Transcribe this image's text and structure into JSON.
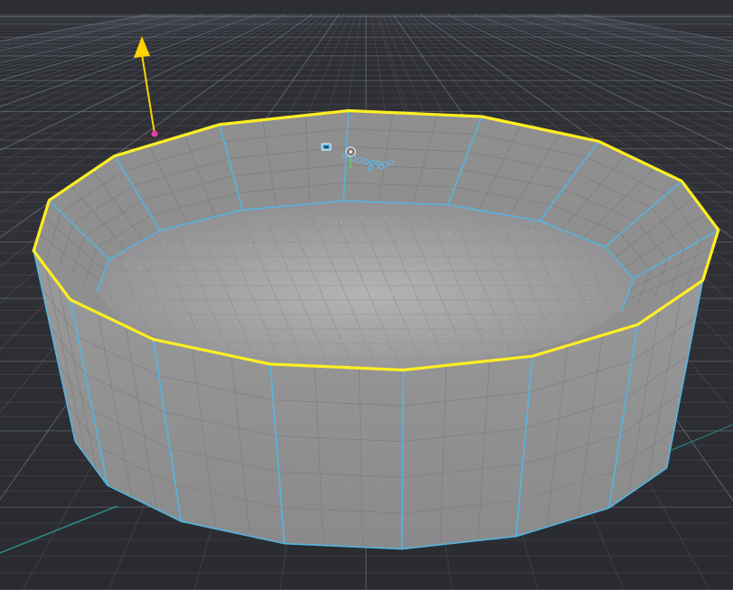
{
  "viewport": {
    "mode": "edit-mesh",
    "background_color": "#2d2e33",
    "grid_color": "#7a8292",
    "grid_accent_color": "#8a5a3a",
    "axis_line_color": "#2a9e9e"
  },
  "mesh": {
    "shape": "open cylinder",
    "sides": 16,
    "wall_rows": 5,
    "wall_cols_per_side": 3,
    "surface_color": "#8f8f90",
    "floor_color": "#a4a4a6",
    "edge_color": "#4fb8e8",
    "selected_edge_loop": "top rim",
    "selected_edge_color": "#ffee22"
  },
  "gizmo": {
    "axis_arrow_color": "#ffd400",
    "handle_color": "#e040a0"
  },
  "widgets": {
    "camera_icon": "camera-icon",
    "light_icon": "light-icon",
    "particles_icon": "particle-emitter-icon",
    "accent_color": "#5fb7e8"
  }
}
